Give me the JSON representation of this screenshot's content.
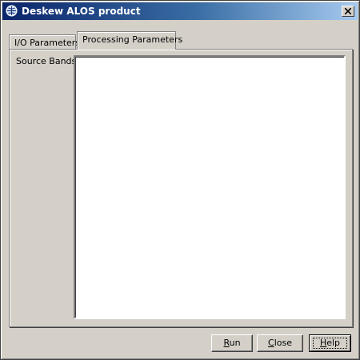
{
  "window": {
    "title": "Deskew ALOS product",
    "close_glyph": "✕"
  },
  "tabs": [
    {
      "label": "I/O Parameters",
      "selected": false
    },
    {
      "label": "Processing Parameters",
      "selected": true
    }
  ],
  "processing": {
    "source_bands_label": "Source Bands:",
    "source_bands": []
  },
  "buttons": {
    "run": {
      "mnemonic": "R",
      "rest": "un"
    },
    "close": {
      "mnemonic": "C",
      "rest": "lose"
    },
    "help": {
      "mnemonic": "H",
      "rest": "elp"
    }
  },
  "colors": {
    "title_start": "#0a246a",
    "title_end": "#a6caf0",
    "face": "#d4d0c8"
  }
}
